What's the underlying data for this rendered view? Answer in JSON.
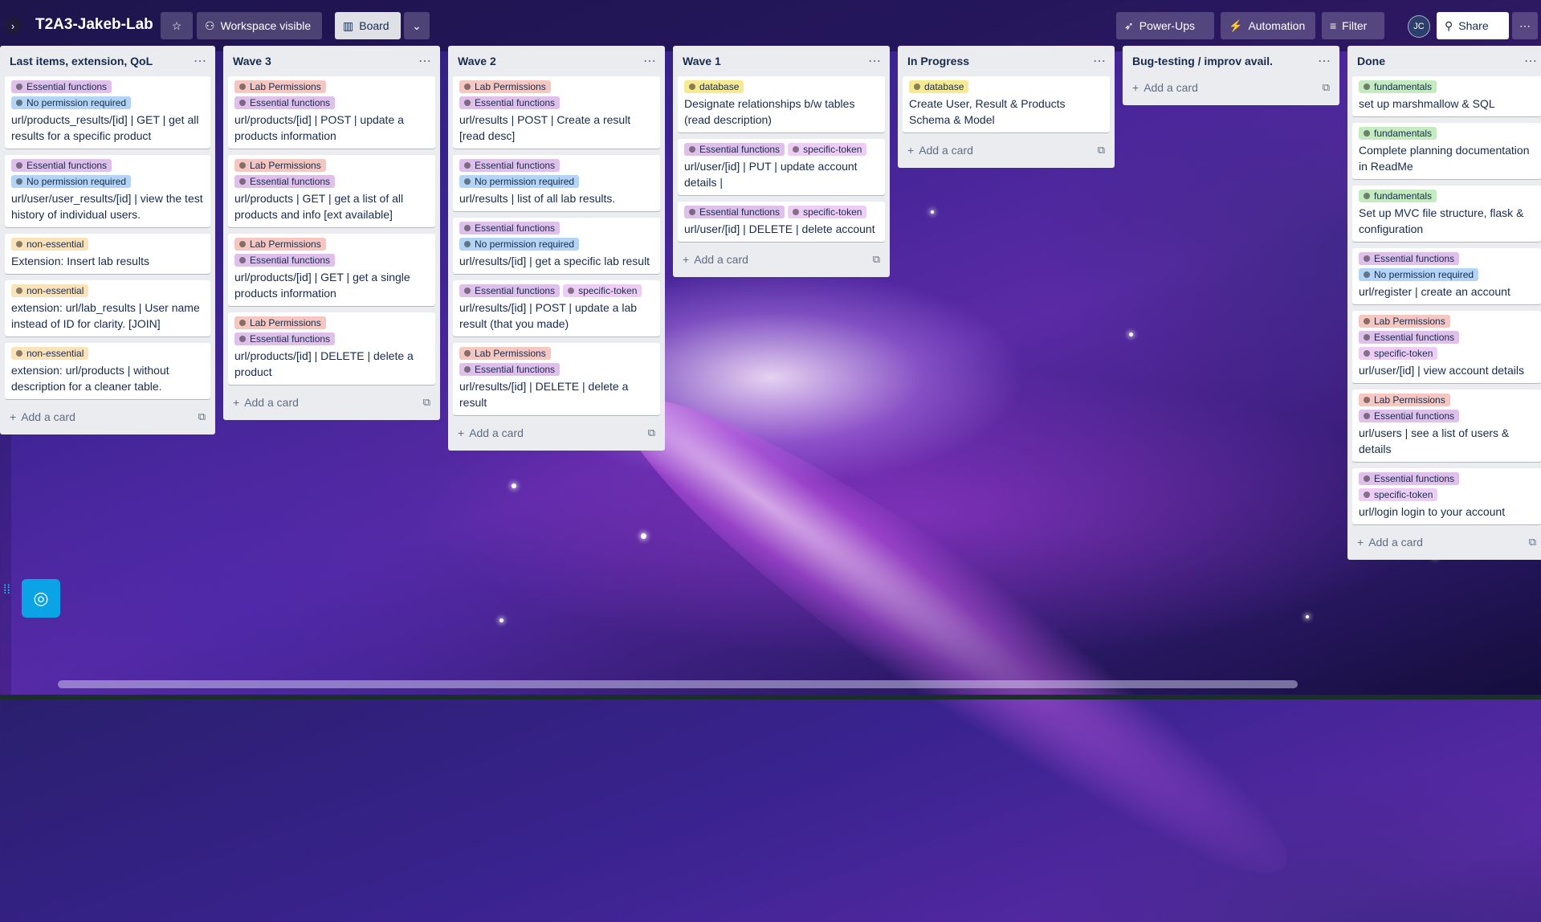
{
  "header": {
    "board_title": "T2A3-Jakeb-Lab",
    "workspace_visible": "Workspace visible",
    "board_view": "Board",
    "power_ups": "Power-Ups",
    "automation": "Automation",
    "filter": "Filter",
    "avatar_initials": "JC",
    "share": "Share"
  },
  "label_colors": {
    "Essential functions": "#dfc0eb",
    "No permission required": "#b3d4f5",
    "non-essential": "#fce2b8",
    "Lab Permissions": "#f5c7c0",
    "database": "#f5ea92",
    "specific-token": "#eecdf5",
    "fundamentals": "#c5ebc0"
  },
  "add_card_label": "Add a card",
  "lists": [
    {
      "title": "Last items, extension, QoL",
      "cards": [
        {
          "labels": [
            "Essential functions",
            "No permission required"
          ],
          "text": "url/products_results/[id] | GET | get all results for a specific product"
        },
        {
          "labels": [
            "Essential functions",
            "No permission required"
          ],
          "text": "url/user/user_results/[id] | view the test history of individual users."
        },
        {
          "labels": [
            "non-essential"
          ],
          "text": "Extension: Insert lab results"
        },
        {
          "labels": [
            "non-essential"
          ],
          "text": "extension: url/lab_results | User name instead of ID for clarity. [JOIN]"
        },
        {
          "labels": [
            "non-essential"
          ],
          "text": "extension: url/products | without description for a cleaner table."
        }
      ]
    },
    {
      "title": "Wave 3",
      "cards": [
        {
          "labels": [
            "Lab Permissions",
            "Essential functions"
          ],
          "text": "url/products/[id] | POST | update a products information"
        },
        {
          "labels": [
            "Lab Permissions",
            "Essential functions"
          ],
          "text": "url/products | GET | get a list of all products and info [ext available]"
        },
        {
          "labels": [
            "Lab Permissions",
            "Essential functions"
          ],
          "text": "url/products/[id] | GET | get a single products information"
        },
        {
          "labels": [
            "Lab Permissions",
            "Essential functions"
          ],
          "text": "url/products/[id] | DELETE | delete a product"
        }
      ]
    },
    {
      "title": "Wave 2",
      "cards": [
        {
          "labels": [
            "Lab Permissions",
            "Essential functions"
          ],
          "text": "url/results | POST | Create a result [read desc]"
        },
        {
          "labels": [
            "Essential functions",
            "No permission required"
          ],
          "text": "url/results | list of all lab results."
        },
        {
          "labels": [
            "Essential functions",
            "No permission required"
          ],
          "text": "url/results/[id] | get a specific lab result"
        },
        {
          "labels": [
            "Essential functions",
            "specific-token"
          ],
          "text": "url/results/[id] | POST | update a lab result (that you made)"
        },
        {
          "labels": [
            "Lab Permissions",
            "Essential functions"
          ],
          "text": "url/results/[id] | DELETE | delete a result"
        }
      ]
    },
    {
      "title": "Wave 1",
      "cards": [
        {
          "labels": [
            "database"
          ],
          "text": "Designate relationships b/w tables (read description)"
        },
        {
          "labels": [
            "Essential functions",
            "specific-token"
          ],
          "text": "url/user/[id] | PUT | update account details |"
        },
        {
          "labels": [
            "Essential functions",
            "specific-token"
          ],
          "text": "url/user/[id] | DELETE | delete account"
        }
      ]
    },
    {
      "title": "In Progress",
      "cards": [
        {
          "labels": [
            "database"
          ],
          "text": "Create User, Result & Products Schema & Model"
        }
      ]
    },
    {
      "title": "Bug-testing / improv avail.",
      "cards": []
    },
    {
      "title": "Done",
      "cards": [
        {
          "labels": [
            "fundamentals"
          ],
          "text": "set up marshmallow & SQL"
        },
        {
          "labels": [
            "fundamentals"
          ],
          "text": "Complete planning documentation in ReadMe"
        },
        {
          "labels": [
            "fundamentals"
          ],
          "text": "Set up MVC file structure, flask & configuration"
        },
        {
          "labels": [
            "Essential functions",
            "No permission required"
          ],
          "text": "url/register | create an account"
        },
        {
          "labels": [
            "Lab Permissions",
            "Essential functions",
            "specific-token"
          ],
          "text": "url/user/[id] | view account details"
        },
        {
          "labels": [
            "Lab Permissions",
            "Essential functions"
          ],
          "text": "url/users | see a list of users & details"
        },
        {
          "labels": [
            "Essential functions",
            "specific-token"
          ],
          "text": "url/login login to your account"
        }
      ]
    }
  ]
}
